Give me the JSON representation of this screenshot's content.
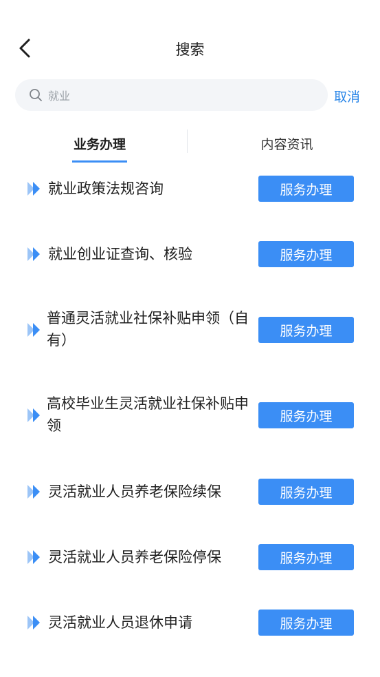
{
  "header": {
    "title": "搜索"
  },
  "search": {
    "value": "就业",
    "cancel_label": "取消"
  },
  "tabs": [
    {
      "label": "业务办理",
      "active": true
    },
    {
      "label": "内容资讯",
      "active": false
    }
  ],
  "services": [
    {
      "name": "就业政策法规咨询",
      "button": "服务办理"
    },
    {
      "name": "就业创业证查询、核验",
      "button": "服务办理"
    },
    {
      "name": "普通灵活就业社保补贴申领（自有）",
      "button": "服务办理"
    },
    {
      "name": "高校毕业生灵活就业社保补贴申领",
      "button": "服务办理"
    },
    {
      "name": "灵活就业人员养老保险续保",
      "button": "服务办理"
    },
    {
      "name": "灵活就业人员养老保险停保",
      "button": "服务办理"
    },
    {
      "name": "灵活就业人员退休申请",
      "button": "服务办理"
    }
  ],
  "colors": {
    "accent": "#3b8ef5",
    "link": "#2a86e8",
    "search_bg": "#f3f5f8"
  }
}
